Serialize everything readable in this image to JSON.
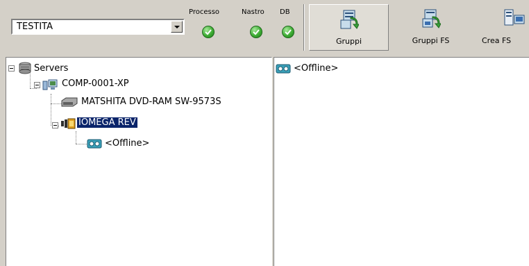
{
  "toolbar": {
    "server_select": {
      "value": "TESTITA"
    },
    "status": [
      {
        "label": "Processo",
        "state": "ok"
      },
      {
        "label": "Nastro",
        "state": "ok"
      },
      {
        "label": "DB",
        "state": "ok"
      }
    ],
    "buttons": [
      {
        "label": "Gruppi",
        "icon": "groups-icon",
        "pressed": true
      },
      {
        "label": "Gruppi FS",
        "icon": "fs-groups-icon",
        "pressed": false
      },
      {
        "label": "Crea FS",
        "icon": "create-fs-icon",
        "pressed": false
      }
    ]
  },
  "tree": {
    "root": {
      "label": "Servers",
      "icon": "servers-icon"
    },
    "computer": {
      "label": "COMP-0001-XP",
      "icon": "computer-icon"
    },
    "dvd": {
      "label": "MATSHITA DVD-RAM SW-9573S",
      "icon": "dvd-drive-icon"
    },
    "rev": {
      "label": "IOMEGA REV",
      "icon": "tape-drive-icon",
      "selected": true
    },
    "offline": {
      "label": "<Offline>",
      "icon": "media-icon"
    }
  },
  "content": {
    "items": [
      {
        "label": "<Offline>",
        "icon": "media-icon"
      }
    ]
  },
  "colors": {
    "selection": "#0a246a",
    "check": "#3fae35",
    "face": "#d4d0c8"
  }
}
